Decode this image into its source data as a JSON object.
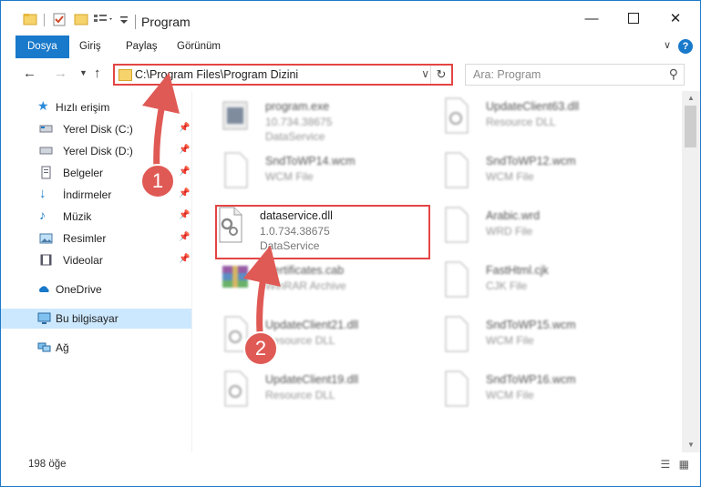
{
  "window": {
    "title": "Program"
  },
  "ribbon": {
    "tabs": [
      "Dosya",
      "Giriş",
      "Paylaş",
      "Görünüm"
    ]
  },
  "address": {
    "path": "C:\\Program Files\\Program Dizini"
  },
  "search": {
    "placeholder": "Ara: Program"
  },
  "sidebar": {
    "quick_access": "Hızlı erişim",
    "items": [
      "Yerel Disk (C:)",
      "Yerel Disk (D:)",
      "Belgeler",
      "İndirmeler",
      "Müzik",
      "Resimler",
      "Videolar"
    ],
    "onedrive": "OneDrive",
    "this_pc": "Bu bilgisayar",
    "network": "Ağ"
  },
  "files": [
    {
      "name": "program.exe",
      "l2": "10.734.38675",
      "l3": "DataService",
      "icon": "exe-icon"
    },
    {
      "name": "UpdateClient63.dll",
      "l2": "Resource DLL",
      "l3": "",
      "icon": "dll-icon"
    },
    {
      "name": "SndToWP14.wcm",
      "l2": "WCM File",
      "l3": "",
      "icon": "file-icon"
    },
    {
      "name": "SndToWP12.wcm",
      "l2": "WCM File",
      "l3": "",
      "icon": "file-icon"
    },
    {
      "name": "dataservice.dll",
      "l2": "1.0.734.38675",
      "l3": "DataService",
      "icon": "dll-icon"
    },
    {
      "name": "Arabic.wrd",
      "l2": "WRD File",
      "l3": "",
      "icon": "file-icon"
    },
    {
      "name": "Certificates.cab",
      "l2": "WinRAR Archive",
      "l3": "",
      "icon": "archive-icon"
    },
    {
      "name": "FastHtml.cjk",
      "l2": "CJK File",
      "l3": "",
      "icon": "file-icon"
    },
    {
      "name": "UpdateClient21.dll",
      "l2": "Resource DLL",
      "l3": "",
      "icon": "dll-icon"
    },
    {
      "name": "SndToWP15.wcm",
      "l2": "WCM File",
      "l3": "",
      "icon": "file-icon"
    },
    {
      "name": "UpdateClient19.dll",
      "l2": "Resource DLL",
      "l3": "",
      "icon": "dll-icon"
    },
    {
      "name": "SndToWP16.wcm",
      "l2": "WCM File",
      "l3": "",
      "icon": "file-icon"
    }
  ],
  "status": {
    "count": "198 öğe"
  },
  "annotations": {
    "badge1": "1",
    "badge2": "2"
  },
  "colors": {
    "accent": "#1979ca",
    "highlight": "#e34545"
  }
}
